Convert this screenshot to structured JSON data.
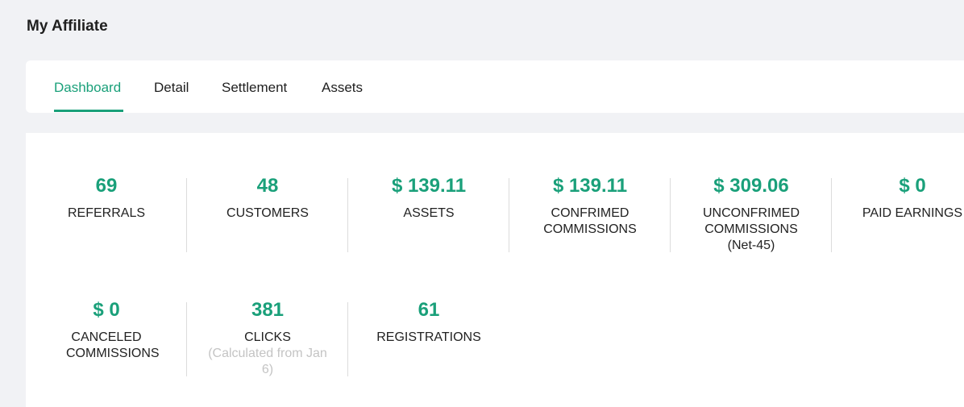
{
  "header": {
    "title": "My Affiliate"
  },
  "tabs": [
    {
      "label": "Dashboard",
      "active": true
    },
    {
      "label": "Detail",
      "active": false
    },
    {
      "label": "Settlement",
      "active": false
    },
    {
      "label": "Assets",
      "active": false
    }
  ],
  "accent_color": "#1aa07a",
  "stats": [
    {
      "value": "69",
      "label": "REFERRALS"
    },
    {
      "value": "48",
      "label": "CUSTOMERS"
    },
    {
      "value": "$ 139.11",
      "label": "ASSETS"
    },
    {
      "value": "$ 139.11",
      "label": "CONFRIMED COMMISSIONS"
    },
    {
      "value": "$ 309.06",
      "label": "UNCONFRIMED COMMISSIONS",
      "note": "(Net-45)"
    },
    {
      "value": "$ 0",
      "label": "PAID EARNINGS"
    },
    {
      "value": "$ 0",
      "label": "CANCELED COMMISSIONS"
    },
    {
      "value": "381",
      "label": "CLICKS",
      "note": "(Calculated from Jan 6)"
    },
    {
      "value": "61",
      "label": "REGISTRATIONS"
    }
  ]
}
